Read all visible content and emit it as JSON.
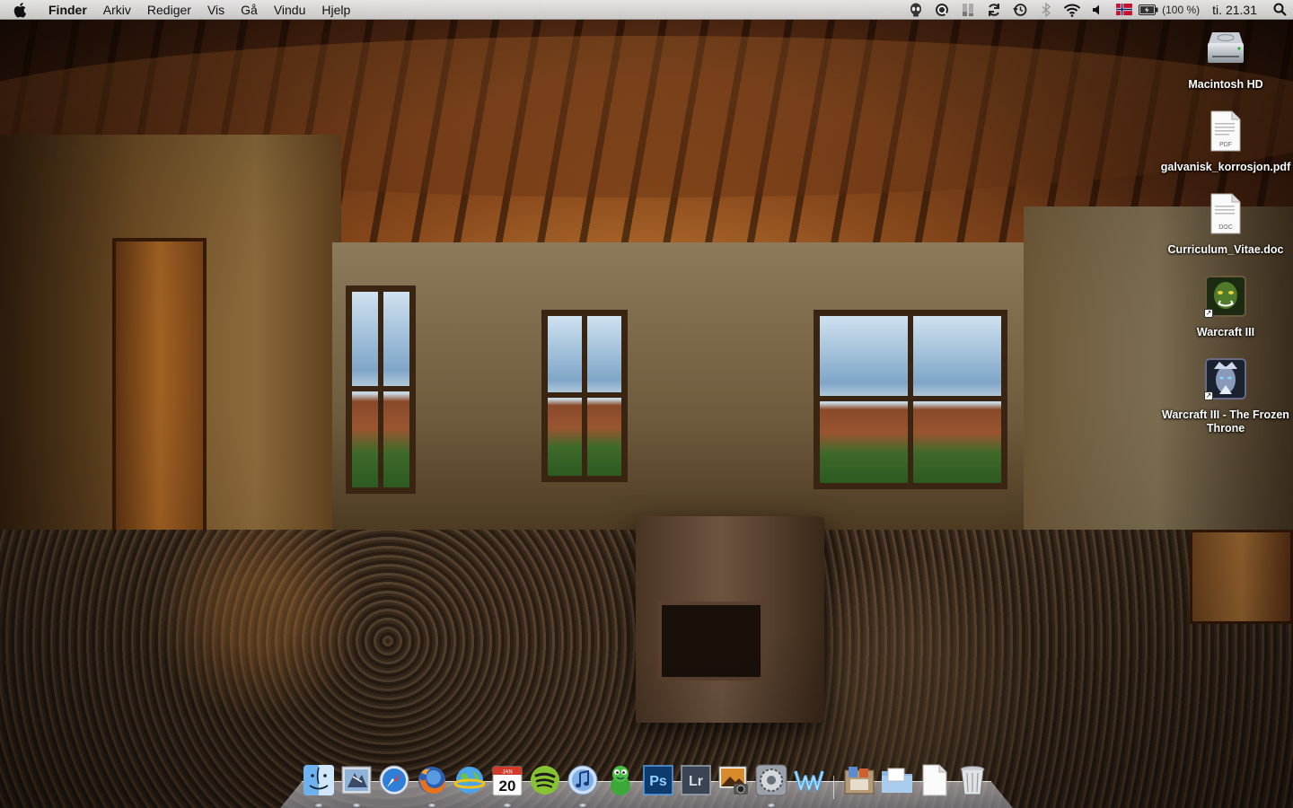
{
  "menubar": {
    "app_name": "Finder",
    "menus": [
      "Arkiv",
      "Rediger",
      "Vis",
      "Gå",
      "Vindu",
      "Hjelp"
    ],
    "battery_text": "(100 %)",
    "clock": "ti. 21.31"
  },
  "desktop": {
    "icons": [
      {
        "label": "Macintosh HD",
        "kind": "hard-drive-icon"
      },
      {
        "label": "galvanisk_korrosjon.pdf",
        "kind": "pdf-document-icon",
        "badge": "PDF"
      },
      {
        "label": "Curriculum_Vitae.doc",
        "kind": "doc-document-icon",
        "badge": "DOC"
      },
      {
        "label": "Warcraft III",
        "kind": "warcraft-app-icon"
      },
      {
        "label": "Warcraft III - The Frozen Throne",
        "kind": "frozen-throne-app-icon"
      }
    ]
  },
  "dock": {
    "calendar_day": "20",
    "calendar_month": "JAN",
    "photoshop_label": "Ps",
    "lightroom_label": "Lr",
    "items": [
      "finder-icon",
      "mail-icon",
      "safari-icon",
      "firefox-icon",
      "network-globe-icon",
      "ical-icon",
      "spotify-icon",
      "itunes-icon",
      "adium-icon",
      "photoshop-icon",
      "lightroom-icon",
      "image-capture-icon",
      "system-preferences-icon",
      "wine-icon",
      "applications-stack-icon",
      "documents-folder-icon",
      "file-icon",
      "trash-icon"
    ]
  },
  "colors": {
    "menubar_bg": "#e6e6e6",
    "label_text": "#ffffff",
    "flag_red": "#c8102e",
    "flag_blue": "#00205b"
  }
}
